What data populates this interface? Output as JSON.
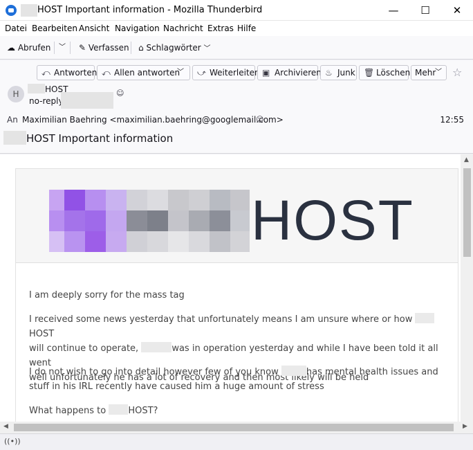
{
  "window": {
    "title": "HOST Important information - Mozilla Thunderbird",
    "minimize_glyph": "—",
    "maximize_glyph": "☐",
    "close_glyph": "✕"
  },
  "menu": [
    "Datei",
    "Bearbeiten",
    "Ansicht",
    "Navigation",
    "Nachricht",
    "Extras",
    "Hilfe"
  ],
  "toolbar": {
    "get_mail": "Abrufen",
    "compose": "Verfassen",
    "tags": "Schlagwörter"
  },
  "header_buttons": {
    "reply": "Antworten",
    "reply_all": "Allen antworten",
    "forward": "Weiterleiten",
    "archive": "Archivieren",
    "junk": "Junk",
    "delete": "Löschen",
    "more": "Mehr"
  },
  "message": {
    "avatar_letter": "H",
    "from_name": "HOST",
    "from_email": "no-reply",
    "to_label": "An",
    "to_value": "Maximilian Baehring <maximilian.baehring@googlemail.com>",
    "time": "12:55",
    "subject": "HOST Important information"
  },
  "body": {
    "logo_text": "HOST",
    "p1": "I am deeply sorry for the mass tag",
    "p2_line1": "I received some news yesterday that unfortunately means I am unsure where or how",
    "p2_line1b": "HOST",
    "p2_line2a": "will continue to operate,",
    "p2_line2b": "was in operation yesterday and while I have been told it all went",
    "p2_line3": "well unfortunately he has a lot of recovery and then most likely will be held",
    "p3_line1a": "I do not wish to go into detail however few of you know",
    "p3_line1b": "has mental health issues and",
    "p3_line2": "stuff in his IRL recently have caused him a huge amount of stress",
    "p4a": "What happens to",
    "p4b": "HOST?"
  },
  "colors": {
    "accent": "#1e6fd9",
    "logo_text": "#2a3140",
    "logo_purple": "#a06ee8"
  }
}
